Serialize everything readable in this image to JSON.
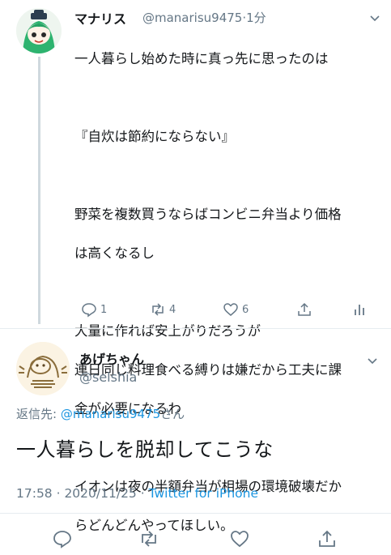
{
  "parent_tweet": {
    "name": "マナリス",
    "handle": "@manarisu9475",
    "separator": "·",
    "time": "1分",
    "lines": [
      "一人暮らし始めた時に真っ先に思ったのは",
      "",
      "『自炊は節約にならない』",
      "",
      "野菜を複数買うならばコンビニ弁当より価格",
      "は高くなるし",
      "",
      "大量に作れば安上がりだろうが",
      "連日同じ料理食べる縛りは嫌だから工夫に課",
      "金が必要になるわ",
      "",
      "イオンは夜の半額弁当が相場の環境破壊だか",
      "らどんどんやってほしい。"
    ],
    "reply_count": "1",
    "retweet_count": "4",
    "like_count": "6",
    "icons": [
      "chevron-down-icon",
      "reply-icon",
      "retweet-icon",
      "like-icon",
      "share-icon",
      "analytics-icon"
    ]
  },
  "main_tweet": {
    "name": "あげちゃん",
    "handle": "@selshia",
    "reply_prefix": "返信先: ",
    "reply_mention": "@manarisu9475",
    "reply_suffix": "さん",
    "text": "一人暮らしを脱却してこうな",
    "time": "17:58 · 2020/11/25 · ",
    "source": "Twitter for iPhone",
    "icons": [
      "chevron-down-icon",
      "reply-icon",
      "retweet-icon",
      "like-icon",
      "share-icon"
    ]
  },
  "colors": {
    "link": "#1b95e0",
    "secondary": "#657786",
    "text": "#14171a"
  }
}
